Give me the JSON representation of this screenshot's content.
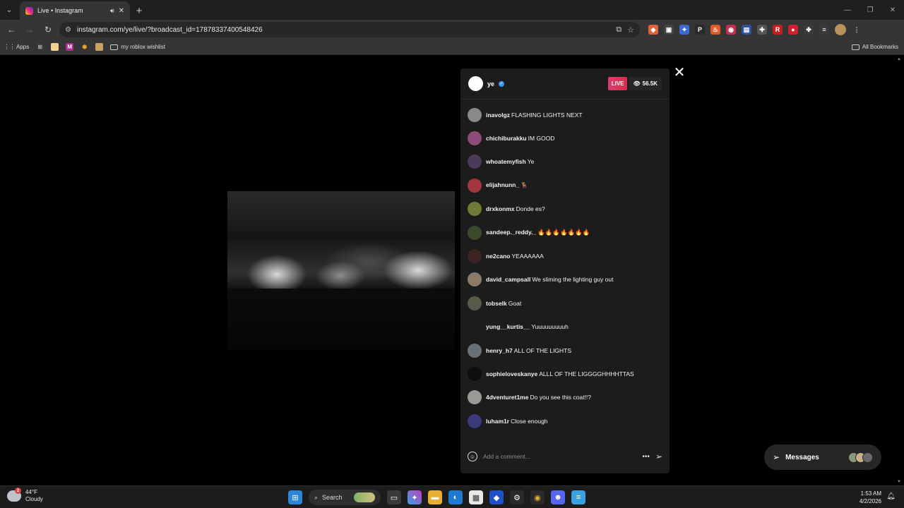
{
  "browser": {
    "tab": {
      "title": "Live • Instagram"
    },
    "address": {
      "url": "instagram.com/ye/live/?broadcast_id=17878337400548426"
    },
    "bookmarks": [
      {
        "label": "Apps",
        "icon": "apps-grid-icon"
      },
      {
        "label": "my roblox wishlist",
        "icon": "folder-icon"
      }
    ],
    "all_bookmarks": "All Bookmarks"
  },
  "live": {
    "host": {
      "username": "ye",
      "verified": true
    },
    "badge": "LIVE",
    "viewers": "56.5K",
    "comments": [
      {
        "user": "inavolgz",
        "text": "FLASHING LIGHTS NEXT",
        "avatar_color": "#8a8a8a"
      },
      {
        "user": "chichiburakku",
        "text": "IM GOOD",
        "avatar_color": "#8e4a78"
      },
      {
        "user": "whoatemyfish",
        "text": "Ye",
        "avatar_color": "#4b3a5a"
      },
      {
        "user": "elijahnunn_",
        "text": "🦌",
        "avatar_color": "#a0363e"
      },
      {
        "user": "drxkonmx",
        "text": "Donde es?",
        "avatar_color": "#6f7a3a"
      },
      {
        "user": "sandeep._reddy._",
        "text": "🔥🔥🔥🔥🔥🔥🔥",
        "avatar_color": "#3c4a2c"
      },
      {
        "user": "ne2cano",
        "text": "YEAAAAAA",
        "avatar_color": "#3a2424"
      },
      {
        "user": "david_campsall",
        "text": "We sliming the lighting guy out",
        "avatar_color": "#8c7a68"
      },
      {
        "user": "tobselk",
        "text": "Goat",
        "avatar_color": "#5a5a4a"
      },
      {
        "user": "yung__kurtis__",
        "text": "Yuuuuuuuuuh",
        "avatar_color": "#1c1c1c"
      },
      {
        "user": "henry_h7",
        "text": "ALL OF THE LIGHTS",
        "avatar_color": "#6a7078"
      },
      {
        "user": "sophieloveskanye",
        "text": "ALLL OF THE LIGGGGHHHHTTAS",
        "avatar_color": "#0e0e0e"
      },
      {
        "user": "4dventuret1me",
        "text": "Do you see this coat!!?",
        "avatar_color": "#9a9a94"
      },
      {
        "user": "luham1r",
        "text": "Close enough",
        "avatar_color": "#3c3a7a"
      }
    ],
    "comment_placeholder": "Add a comment..."
  },
  "messages": {
    "label": "Messages"
  },
  "taskbar": {
    "weather": {
      "temp": "44°F",
      "condition": "Cloudy",
      "badge": "2"
    },
    "search_label": "Search",
    "time": "1:53 AM",
    "date": "4/2/2026"
  }
}
